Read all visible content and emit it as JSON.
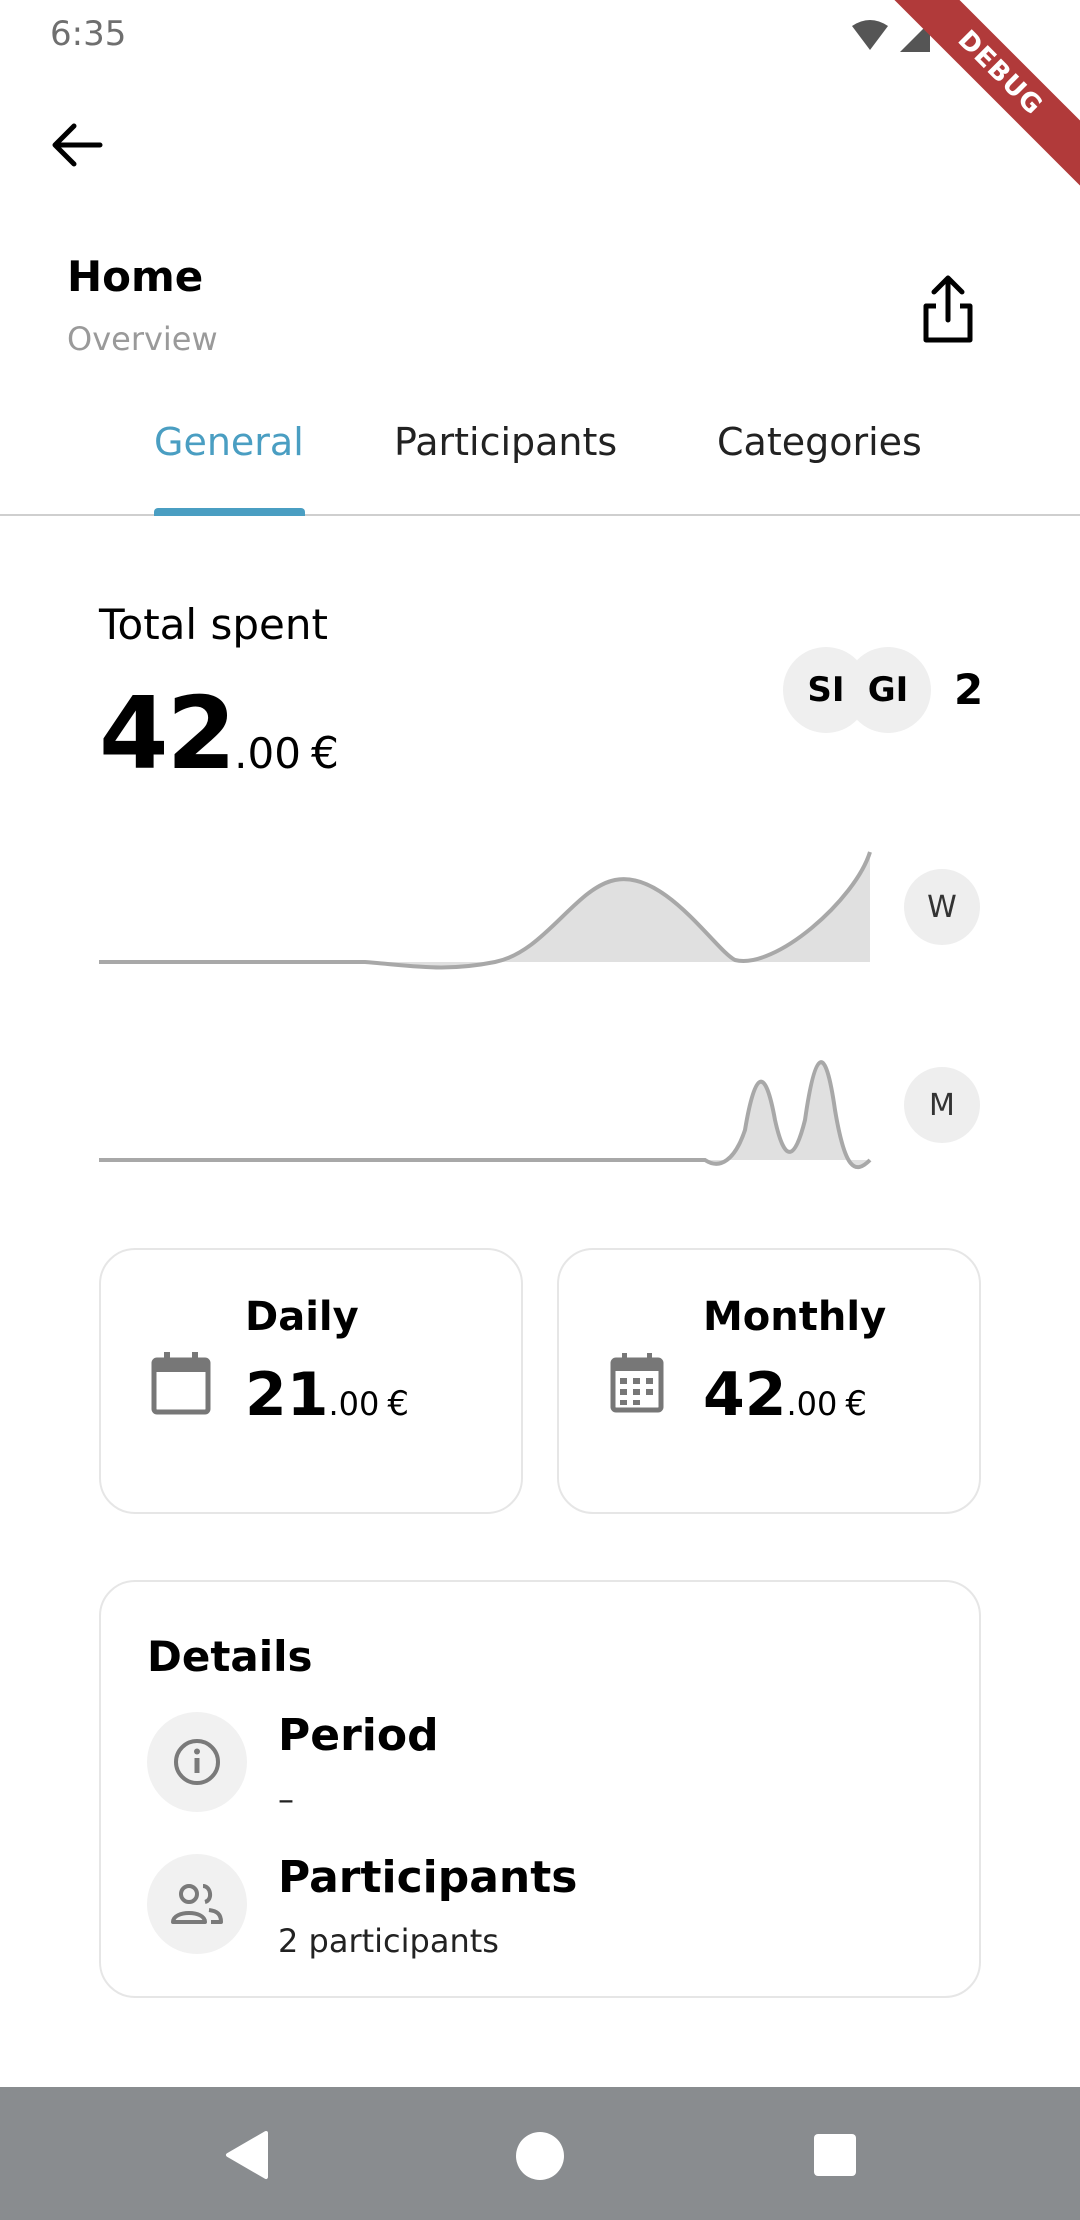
{
  "status_bar": {
    "time": "6:35",
    "debug_label": "DEBUG"
  },
  "header": {
    "title": "Home",
    "subtitle": "Overview"
  },
  "tabs": [
    {
      "label": "General",
      "active": true
    },
    {
      "label": "Participants",
      "active": false
    },
    {
      "label": "Categories",
      "active": false
    }
  ],
  "total": {
    "label": "Total spent",
    "integer": "42",
    "decimal": ".00",
    "currency": "€"
  },
  "participants_summary": {
    "avatars": [
      "SI",
      "GI"
    ],
    "count": "2"
  },
  "range_chips": {
    "week": "W",
    "month": "M"
  },
  "stats": {
    "daily": {
      "title": "Daily",
      "integer": "21",
      "decimal": ".00",
      "currency": "€"
    },
    "monthly": {
      "title": "Monthly",
      "integer": "42",
      "decimal": ".00",
      "currency": "€"
    }
  },
  "details": {
    "heading": "Details",
    "period": {
      "title": "Period",
      "value": "–"
    },
    "participants": {
      "title": "Participants",
      "value": "2 participants"
    }
  },
  "colors": {
    "accent": "#4a9ec2",
    "chart_fill": "#e0e0e0",
    "chart_line": "#a8a8a8",
    "navbar": "#898c8f"
  }
}
